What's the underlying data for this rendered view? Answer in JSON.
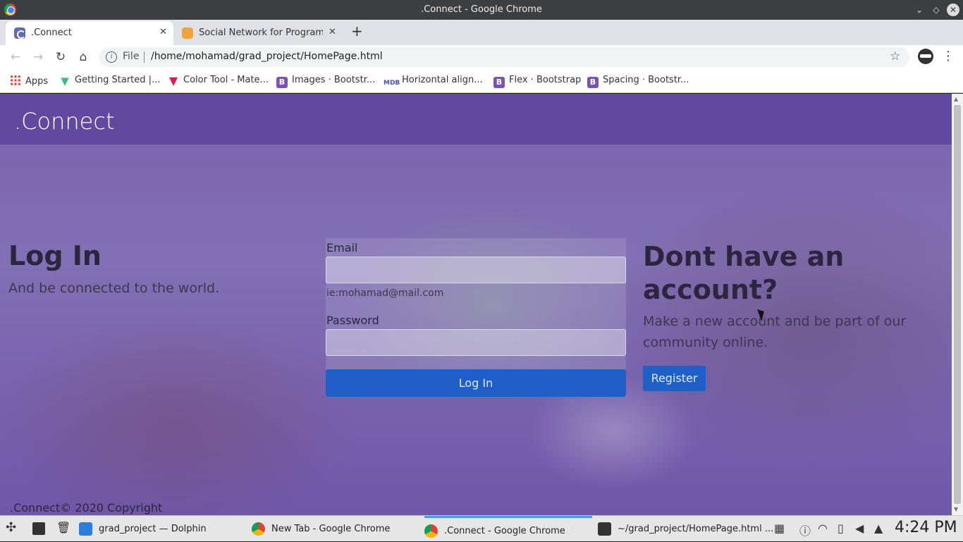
{
  "window": {
    "title": ".Connect - Google Chrome"
  },
  "tabs": [
    {
      "label": ".Connect",
      "close": "✕"
    },
    {
      "label": "Social Network for Programmers",
      "close": "✕"
    }
  ],
  "newtab_symbol": "+",
  "toolbar": {
    "scheme": "File",
    "url": "/home/mohamad/grad_project/HomePage.html"
  },
  "bookmarks": [
    {
      "label": "Apps"
    },
    {
      "label": "Getting Started |..."
    },
    {
      "label": "Color Tool - Mate..."
    },
    {
      "label": "Images · Bootstr..."
    },
    {
      "label": "Horizontal align..."
    },
    {
      "label": "Flex · Bootstrap"
    },
    {
      "label": "Spacing · Bootstr..."
    }
  ],
  "page": {
    "brand": ".Connect",
    "login": {
      "heading": "Log In",
      "subheading": "And be connected to the world.",
      "email_label": "Email",
      "email_help": "ie:mohamad@mail.com",
      "password_label": "Password",
      "submit_label": "Log In"
    },
    "register": {
      "heading": "Dont have an account?",
      "subheading": "Make a new account and be part of our community online.",
      "button_label": "Register"
    },
    "footer": ".Connect© 2020 Copyright"
  },
  "taskbar": {
    "tasks": [
      {
        "label": "grad_project — Dolphin"
      },
      {
        "label": "New Tab - Google Chrome"
      },
      {
        "label": ".Connect - Google Chrome"
      },
      {
        "label": "~/grad_project/HomePage.html ..."
      }
    ],
    "clock": "4:24 PM"
  },
  "colors": {
    "navbar": "#6249a0",
    "button": "#1f5fc8"
  }
}
